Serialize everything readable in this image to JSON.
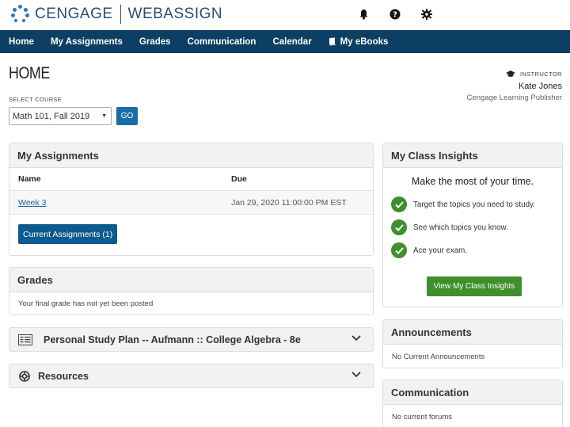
{
  "brand": {
    "name_left": "CENGAGE",
    "name_right": "WEBASSIGN"
  },
  "top_icons": [
    "bell-icon",
    "help-icon",
    "gear-icon"
  ],
  "nav": {
    "items": [
      {
        "label": "Home"
      },
      {
        "label": "My Assignments"
      },
      {
        "label": "Grades"
      },
      {
        "label": "Communication"
      },
      {
        "label": "Calendar"
      },
      {
        "label": "My eBooks",
        "icon": "book-icon"
      }
    ]
  },
  "page": {
    "title": "HOME",
    "select_label": "SELECT COURSE",
    "course_value": "Math 101, Fall 2019",
    "go_label": "GO"
  },
  "instructor": {
    "role": "INSTRUCTOR",
    "name": "Kate Jones",
    "org": "Cengage Learning Publisher"
  },
  "assignments": {
    "title": "My Assignments",
    "col_name": "Name",
    "col_due": "Due",
    "rows": [
      {
        "name": "Week 3",
        "due": "Jan 29, 2020 11:00:00 PM EST"
      }
    ],
    "current_button": "Current Assignments (1)"
  },
  "grades": {
    "title": "Grades",
    "message": "Your final grade has not yet been posted"
  },
  "study_plan": {
    "title": "Personal Study Plan -- Aufmann :: College Algebra - 8e"
  },
  "resources": {
    "title": "Resources"
  },
  "insights": {
    "title": "My Class Insights",
    "heading": "Make the most of your time.",
    "items": [
      "Target the topics you need to study.",
      "See which topics you know.",
      "Ace your exam."
    ],
    "button": "View My Class Insights"
  },
  "announcements": {
    "title": "Announcements",
    "message": "No Current Announcements"
  },
  "communication": {
    "title": "Communication",
    "message": "No current forums"
  },
  "colors": {
    "nav_bg": "#0c3f63",
    "primary_button": "#0c5a8e",
    "insights_green": "#3f8f2c"
  }
}
